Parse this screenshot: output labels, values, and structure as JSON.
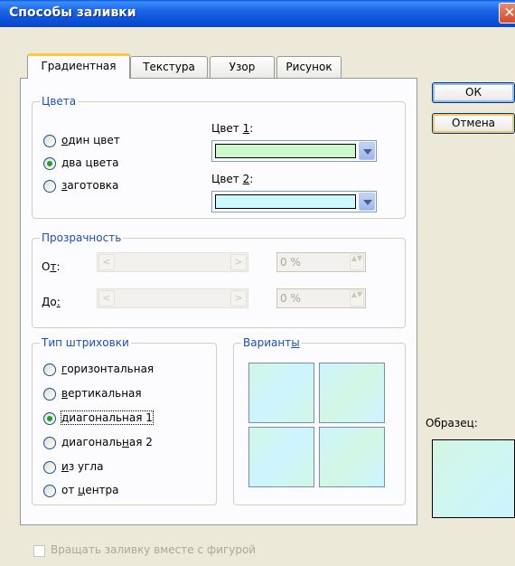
{
  "window": {
    "title": "Способы заливки",
    "close_glyph": "✕"
  },
  "tabs": [
    {
      "label": "Градиентная",
      "active": true
    },
    {
      "label": "Текстура",
      "active": false
    },
    {
      "label": "Узор",
      "active": false
    },
    {
      "label": "Рисунок",
      "active": false
    }
  ],
  "colors_group": {
    "legend": "Цвета",
    "options": [
      {
        "pre": "",
        "ul": "о",
        "post": "дин цвет",
        "checked": false
      },
      {
        "pre": "",
        "ul": "д",
        "post": "ва цвета",
        "checked": true
      },
      {
        "pre": "",
        "ul": "з",
        "post": "аготовка",
        "checked": false
      }
    ],
    "color1_label_pre": "Цвет ",
    "color1_label_ul": "1",
    "color1_label_post": ":",
    "color1_value": "#ccf8cc",
    "color2_label_pre": "Цвет ",
    "color2_label_ul": "2",
    "color2_label_post": ":",
    "color2_value": "#ccf8ff"
  },
  "transparency_group": {
    "legend": "Прозрачность",
    "from_label_pre": "О",
    "from_label_ul": "т",
    "from_label_post": ":",
    "from_value": "0 %",
    "to_label_pre": "До",
    "to_label_ul": ":",
    "to_label_post": "",
    "to_value": "0 %",
    "left_arrow": "<",
    "right_arrow": ">",
    "spin_glyph": "▲▼"
  },
  "hatch_group": {
    "legend": "Тип штриховки",
    "options": [
      {
        "pre": "",
        "ul": "г",
        "post": "оризонтальная",
        "checked": false
      },
      {
        "pre": "",
        "ul": "в",
        "post": "ертикальная",
        "checked": false
      },
      {
        "pre": "",
        "ul": "д",
        "post": "иагональная 1",
        "checked": true
      },
      {
        "pre": "диагональ",
        "ul": "н",
        "post": "ая 2",
        "checked": false
      },
      {
        "pre": "",
        "ul": "и",
        "post": "з угла",
        "checked": false
      },
      {
        "pre": "от ",
        "ul": "ц",
        "post": "ентра",
        "checked": false
      }
    ]
  },
  "variants_group": {
    "legend_pre": "Вариант",
    "legend_ul": "ы",
    "legend_post": "",
    "swatches": [
      {
        "from": "#d2f7e4",
        "to": "#cdf4ff"
      },
      {
        "from": "#cdf4ff",
        "to": "#d2f7e4"
      },
      {
        "from": "#d2f7e4",
        "to": "#cdf4ff"
      },
      {
        "from": "#cdf4ff",
        "to": "#d2f7e4"
      }
    ]
  },
  "buttons": {
    "ok": "ОК",
    "cancel": "Отмена"
  },
  "sample": {
    "label": "Образец:"
  },
  "rotate_checkbox": {
    "label": "Вращать заливку вместе с фигурой",
    "checked": false
  }
}
